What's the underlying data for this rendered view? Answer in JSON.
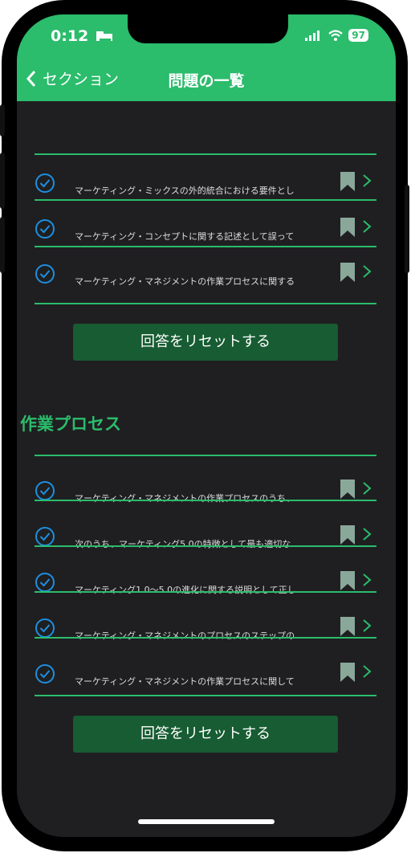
{
  "status": {
    "time": "0:12",
    "battery": "97"
  },
  "nav": {
    "back_label": "セクション",
    "title": "問題の一覧"
  },
  "top_list": [
    "マーケティング・ミックスの外的統合における要件とし",
    "マーケティング・コンセプトに関する記述として誤って",
    "マーケティング・マネジメントの作業プロセスに関する"
  ],
  "reset_label": "回答をリセットする",
  "section2": {
    "title": "作業プロセス",
    "items": [
      "マーケティング・マネジメントの作業プロセスのうち、",
      "次のうち、マーケティング5.0の特徴として最も適切な",
      "マーケティング1.0～5.0の進化に関する説明として正し",
      "マーケティング・マネジメントのプロセスのステップの",
      "マーケティング・マネジメントの作業プロセスに関して"
    ]
  },
  "colors": {
    "accent": "#2bbc6c",
    "check": "#1e8fe0",
    "bookmark": "#8aa89a",
    "reset_bg": "#175c32"
  }
}
